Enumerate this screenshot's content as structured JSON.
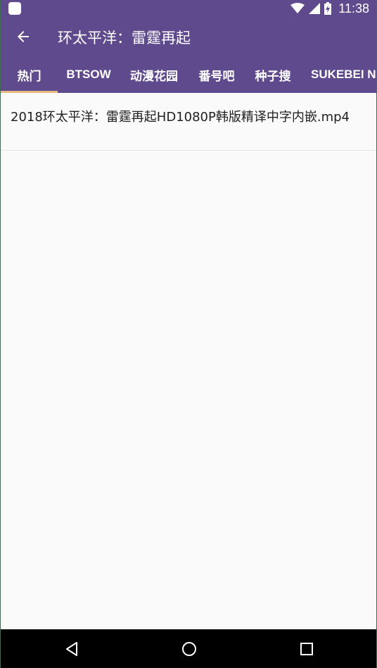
{
  "status_bar": {
    "time": "11:38",
    "icons": [
      "app-notification-icon",
      "wifi-icon",
      "cell-signal-icon",
      "battery-charging-icon"
    ]
  },
  "app_bar": {
    "title": "环太平洋：雷霆再起",
    "back_icon": "arrow-back-icon"
  },
  "tabs": [
    {
      "label": "热门",
      "selected": true
    },
    {
      "label": "BTSOW",
      "selected": false
    },
    {
      "label": "动漫花园",
      "selected": false
    },
    {
      "label": "番号吧",
      "selected": false
    },
    {
      "label": "种子搜",
      "selected": false
    },
    {
      "label": "SUKEBEI NYAA",
      "selected": false
    }
  ],
  "results": [
    {
      "title": "2018环太平洋：雷霆再起HD1080P韩版精译中字内嵌.mp4"
    }
  ],
  "nav_bar": {
    "icons": [
      "back-triangle-icon",
      "home-circle-icon",
      "recents-square-icon"
    ]
  },
  "colors": {
    "primary": "#5e4a8c",
    "tab_indicator": "#e6b77e",
    "background": "#fafafa",
    "text": "#212121"
  }
}
